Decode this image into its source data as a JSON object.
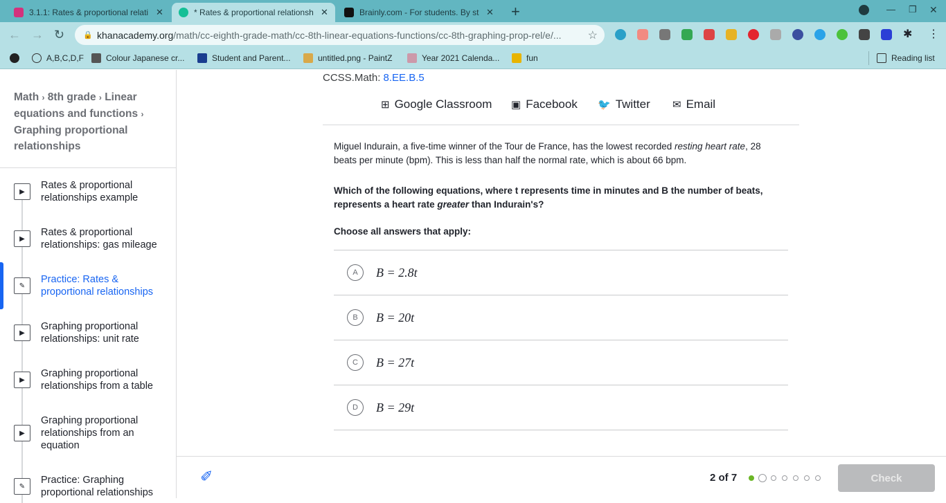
{
  "browser": {
    "tabs": [
      {
        "title": "3.1.1: Rates & proportional relati",
        "icon": "classroom-icon",
        "color": "#d3327c"
      },
      {
        "title": "* Rates & proportional relationsh",
        "icon": "khan-icon",
        "color": "#14bf96"
      },
      {
        "title": "Brainly.com - For students. By st",
        "icon": "brainly-icon",
        "color": "#111111"
      }
    ],
    "url_domain": "khanacademy.org",
    "url_path": "/math/cc-eighth-grade-math/cc-8th-linear-equations-functions/cc-8th-graphing-prop-rel/e/...",
    "bookmarks": [
      "A,B,C,D,F",
      "Colour Japanese cr...",
      "Student and Parent...",
      "untitled.png - PaintZ",
      "Year 2021 Calenda...",
      "fun"
    ],
    "reading_list": "Reading list"
  },
  "sidebar": {
    "breadcrumbs": [
      "Math",
      "8th grade",
      "Linear equations and functions",
      "Graphing proportional relationships"
    ],
    "items": [
      {
        "label": "Rates & proportional relationships example",
        "type": "video"
      },
      {
        "label": "Rates & proportional relationships: gas mileage",
        "type": "video"
      },
      {
        "label": "Practice: Rates & proportional relationships",
        "type": "exercise",
        "selected": true
      },
      {
        "label": "Graphing proportional relationships: unit rate",
        "type": "video"
      },
      {
        "label": "Graphing proportional relationships from a table",
        "type": "video"
      },
      {
        "label": "Graphing proportional relationships from an equation",
        "type": "video"
      },
      {
        "label": "Practice: Graphing proportional relationships",
        "type": "exercise"
      }
    ]
  },
  "main": {
    "ccss_label": "CCSS.Math:",
    "ccss_code": "8.EE.B.5",
    "share": [
      "Google Classroom",
      "Facebook",
      "Twitter",
      "Email"
    ],
    "problem_1": "Miguel Indurain, a five-time winner of the Tour de France, has the lowest recorded ",
    "problem_em": "resting heart rate",
    "problem_2": ", 28 beats per minute (bpm). This is less than half the normal rate, which is about 66 bpm.",
    "question_1": "Which of the following equations, where t represents time in minutes and B the number of beats, represents a heart rate ",
    "question_em": "greater",
    "question_2": " than Indurain's?",
    "instruction": "Choose all answers that apply:",
    "options": [
      {
        "letter": "A",
        "eq": "B = 2.8t"
      },
      {
        "letter": "B",
        "eq": "B = 20t"
      },
      {
        "letter": "C",
        "eq": "B = 27t"
      },
      {
        "letter": "D",
        "eq": "B = 29t"
      }
    ]
  },
  "footer": {
    "progress": "2 of 7",
    "current": 2,
    "total": 7,
    "completed": 1,
    "check": "Check",
    "accent": "#6bb626"
  }
}
